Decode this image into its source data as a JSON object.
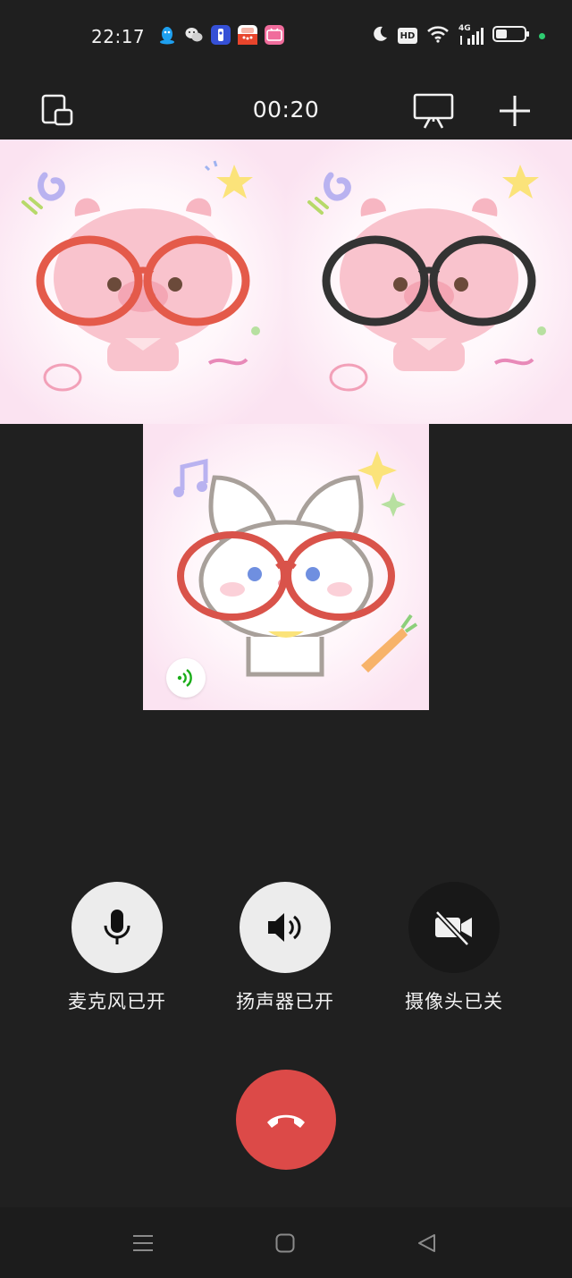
{
  "status_bar": {
    "time": "22:17",
    "notifications": [
      {
        "icon": "qq-icon",
        "color": "#1ea0f0"
      },
      {
        "icon": "wechat-icon",
        "color": "#e8e8e8"
      },
      {
        "icon": "baidu-app-icon",
        "color": "#3550d6"
      },
      {
        "icon": "news-app-icon",
        "color": "#e8452c"
      },
      {
        "icon": "bilibili-icon",
        "color": "#f06c9c"
      }
    ],
    "hd_label": "HD",
    "network_label": "4G"
  },
  "call": {
    "duration": "00:20"
  },
  "controls": {
    "microphone_label": "麦克风已开",
    "speaker_label": "扬声器已开",
    "camera_label": "摄像头已关"
  },
  "colors": {
    "background": "#202020",
    "hangup": "#dc4a48",
    "control_on": "#ececec",
    "control_off": "#181818",
    "speaking_indicator": "#1aad19"
  }
}
